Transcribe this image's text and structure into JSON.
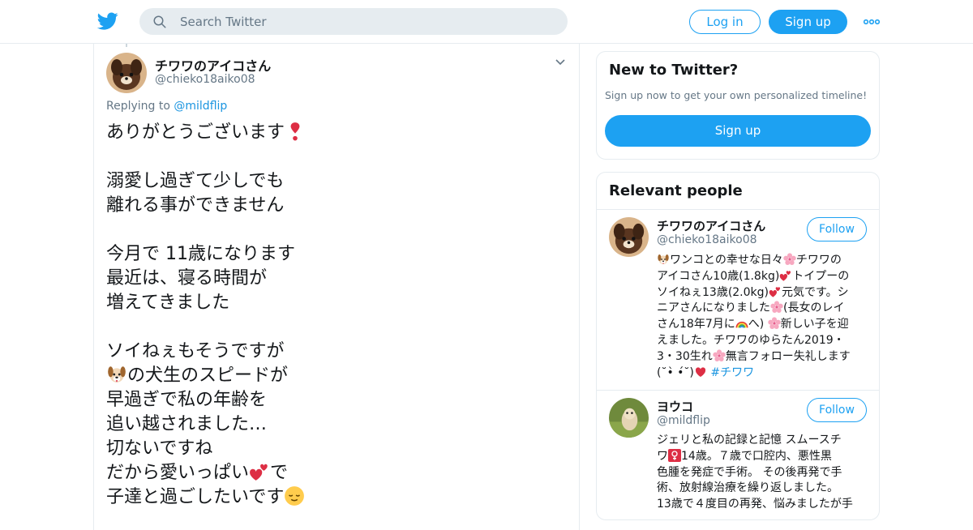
{
  "header": {
    "search_placeholder": "Search Twitter",
    "login_label": "Log in",
    "signup_label": "Sign up",
    "brand_color": "#1da1f2"
  },
  "tweet": {
    "author_name": "チワワのアイコさん",
    "author_handle": "@chieko18aiko08",
    "replying_prefix": "Replying to ",
    "replying_to": "@mildflip",
    "lines": [
      {
        "text": "ありがとうございます",
        "icon_after": "heavy-heart-exclamation-icon"
      },
      {
        "text": ""
      },
      {
        "text": "溺愛し過ぎて少しでも"
      },
      {
        "text": "離れる事ができません"
      },
      {
        "text": ""
      },
      {
        "text": "今月で 11歳になります"
      },
      {
        "text": "最近は、寝る時間が"
      },
      {
        "text": "増えてきました"
      },
      {
        "text": ""
      },
      {
        "text": "ソイねぇもそうですが"
      },
      {
        "icon_before": "dog-face-icon",
        "text": "の犬生のスピードが"
      },
      {
        "text": "早過ぎで私の年齢を"
      },
      {
        "text": "追い越されました…"
      },
      {
        "text": "切ないですね"
      },
      {
        "text": "だから愛いっぱい",
        "icon_after": "two-hearts-icon",
        "text_after": "で"
      },
      {
        "text": "子達と過ごしたいです",
        "icon_after": "relieved-face-icon"
      }
    ]
  },
  "sidebar": {
    "new_to_twitter": {
      "title": "New to Twitter?",
      "subtitle": "Sign up now to get your own personalized timeline!",
      "signup_label": "Sign up"
    },
    "relevant_people": {
      "title": "Relevant people",
      "people": [
        {
          "name": "チワワのアイコさん",
          "handle": "@chieko18aiko08",
          "follow_label": "Follow",
          "bio_lines": [
            [
              {
                "icon": "dog-face-icon"
              },
              {
                "t": "ワンコとの幸せな日々"
              },
              {
                "icon": "cherry-blossom-icon"
              },
              {
                "t": "チワワの"
              }
            ],
            [
              {
                "t": "アイコさん10歳(1.8kg)"
              },
              {
                "icon": "two-hearts-icon"
              },
              {
                "t": "トイプーの"
              }
            ],
            [
              {
                "t": "ソイねぇ13歳(2.0kg)"
              },
              {
                "icon": "two-hearts-icon"
              },
              {
                "t": "元気です。シ"
              }
            ],
            [
              {
                "t": "ニアさんになりました"
              },
              {
                "icon": "cherry-blossom-icon"
              },
              {
                "t": "(長女のレイ"
              }
            ],
            [
              {
                "t": "さん18年7月に"
              },
              {
                "icon": "rainbow-icon"
              },
              {
                "t": "へ) "
              },
              {
                "icon": "cherry-blossom-icon"
              },
              {
                "t": "新しい子を迎"
              }
            ],
            [
              {
                "t": "えました。チワワのゆらたん2019・"
              }
            ],
            [
              {
                "t": "3・30生れ"
              },
              {
                "icon": "cherry-blossom-icon"
              },
              {
                "t": "無言フォロー失礼します"
              }
            ],
            [
              {
                "t": "(˘•̀ •́˘)"
              },
              {
                "icon": "red-heart-icon"
              },
              {
                "t": " "
              },
              {
                "hashtag": "#チワワ"
              }
            ]
          ]
        },
        {
          "name": "ヨウコ",
          "handle": "@mildflip",
          "follow_label": "Follow",
          "bio_lines": [
            [
              {
                "t": "ジェリと私の記録と記憶 スムースチ"
              }
            ],
            [
              {
                "t": "ワ"
              },
              {
                "icon": "female-sign-icon"
              },
              {
                "t": "14歳。７歳で口腔内、悪性黒"
              }
            ],
            [
              {
                "t": "色腫を発症で手術。 その後再発で手"
              }
            ],
            [
              {
                "t": "術、放射線治療を繰り返しました。"
              }
            ],
            [
              {
                "t": "13歳で４度目の再発、悩みましたが手"
              }
            ]
          ]
        }
      ]
    }
  }
}
